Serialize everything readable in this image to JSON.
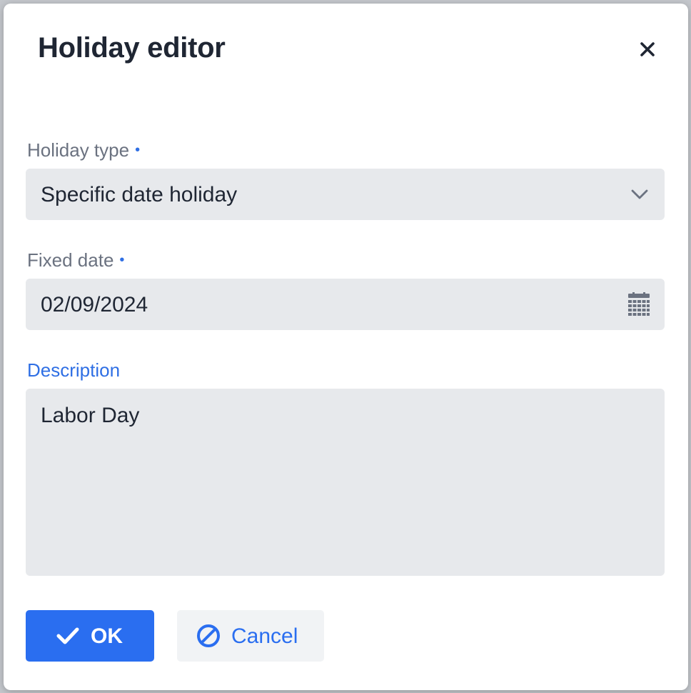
{
  "dialog": {
    "title": "Holiday editor",
    "close_icon": "close-icon"
  },
  "fields": {
    "holiday_type": {
      "label": "Holiday type",
      "required_marker": "•",
      "value": "Specific date holiday",
      "icon": "chevron-down-icon"
    },
    "fixed_date": {
      "label": "Fixed date",
      "required_marker": "•",
      "value": "02/09/2024",
      "icon": "calendar-icon"
    },
    "description": {
      "label": "Description",
      "value": "Labor Day"
    }
  },
  "buttons": {
    "ok": {
      "label": "OK",
      "icon": "check-icon"
    },
    "cancel": {
      "label": "Cancel",
      "icon": "cancel-icon"
    }
  },
  "colors": {
    "accent": "#2a6ef0",
    "field_bg": "#e7e9ec",
    "text": "#1f2633",
    "label": "#6b7280"
  }
}
